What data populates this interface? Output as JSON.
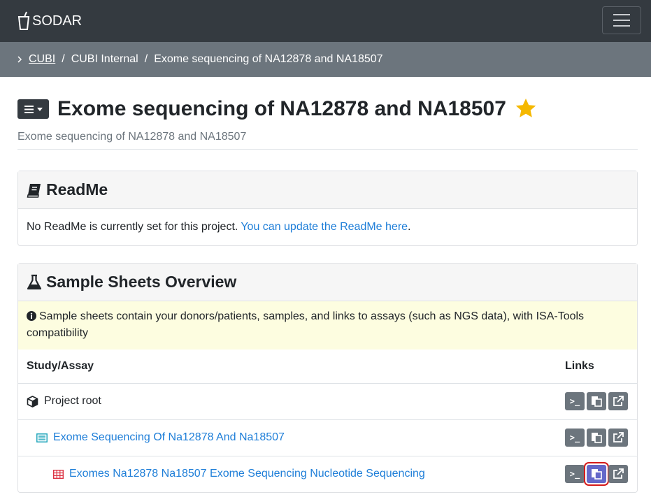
{
  "navbar": {
    "brand": "SODAR",
    "menu_icon": "hamburger-icon"
  },
  "breadcrumb": {
    "items": [
      {
        "label": "CUBI",
        "link": true
      },
      {
        "label": "CUBI Internal",
        "link": false
      },
      {
        "label": "Exome sequencing of NA12878 and NA18507",
        "link": false
      }
    ],
    "separator": "/"
  },
  "project": {
    "title": "Exome sequencing of NA12878 and NA18507",
    "description": "Exome sequencing of NA12878 and NA18507",
    "starred": true
  },
  "readme": {
    "title": "ReadMe",
    "text": "No ReadMe is currently set for this project.",
    "link_text": "You can update the ReadMe here",
    "trailing": "."
  },
  "sheets": {
    "title": "Sample Sheets Overview",
    "info": "Sample sheets contain your donors/patients, samples, and links to assays (such as NGS data), with ISA-Tools compatibility",
    "columns": {
      "name": "Study/Assay",
      "links": "Links"
    },
    "rows": [
      {
        "label": "Project root",
        "icon": "cube-icon"
      },
      {
        "label": "Exome Sequencing Of Na12878 And Na18507",
        "icon": "study-list-icon"
      },
      {
        "label": "Exomes Na12878 Na18507 Exome Sequencing Nucleotide Sequencing",
        "icon": "assay-table-icon"
      }
    ],
    "button_labels": {
      "irods": ">_"
    }
  },
  "colors": {
    "navbar": "#343a40",
    "breadcrumb_bar": "#6c757d",
    "link": "#1e7ed8",
    "info_bg": "#fdfde0",
    "star": "#f5b800",
    "highlight": "#d41a1a"
  }
}
